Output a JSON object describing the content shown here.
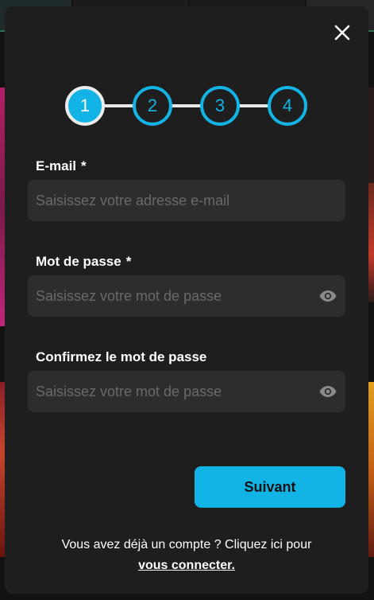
{
  "steps": [
    {
      "label": "1",
      "state": "active"
    },
    {
      "label": "2",
      "state": "inactive"
    },
    {
      "label": "3",
      "state": "inactive"
    },
    {
      "label": "4",
      "state": "inactive"
    }
  ],
  "form": {
    "email": {
      "label": "E-mail",
      "required_mark": "*",
      "placeholder": "Saisissez votre adresse e-mail",
      "value": ""
    },
    "password": {
      "label": "Mot de passe",
      "required_mark": "*",
      "placeholder": "Saisissez votre mot de passe",
      "value": "",
      "toggle_icon": "eye-icon"
    },
    "confirm_password": {
      "label": "Confirmez le mot de passe",
      "placeholder": "Saisissez votre mot de passe",
      "value": "",
      "toggle_icon": "eye-icon"
    }
  },
  "actions": {
    "next_label": "Suivant",
    "close_icon": "close-icon"
  },
  "footer": {
    "text": "Vous avez déjà un compte ? Cliquez ici pour",
    "link": "vous connecter."
  },
  "colors": {
    "accent": "#12b4e6",
    "modal_bg": "#1e1e1e",
    "input_bg": "#2d2d2d",
    "text": "#ffffff",
    "placeholder": "#6a6a6a"
  }
}
